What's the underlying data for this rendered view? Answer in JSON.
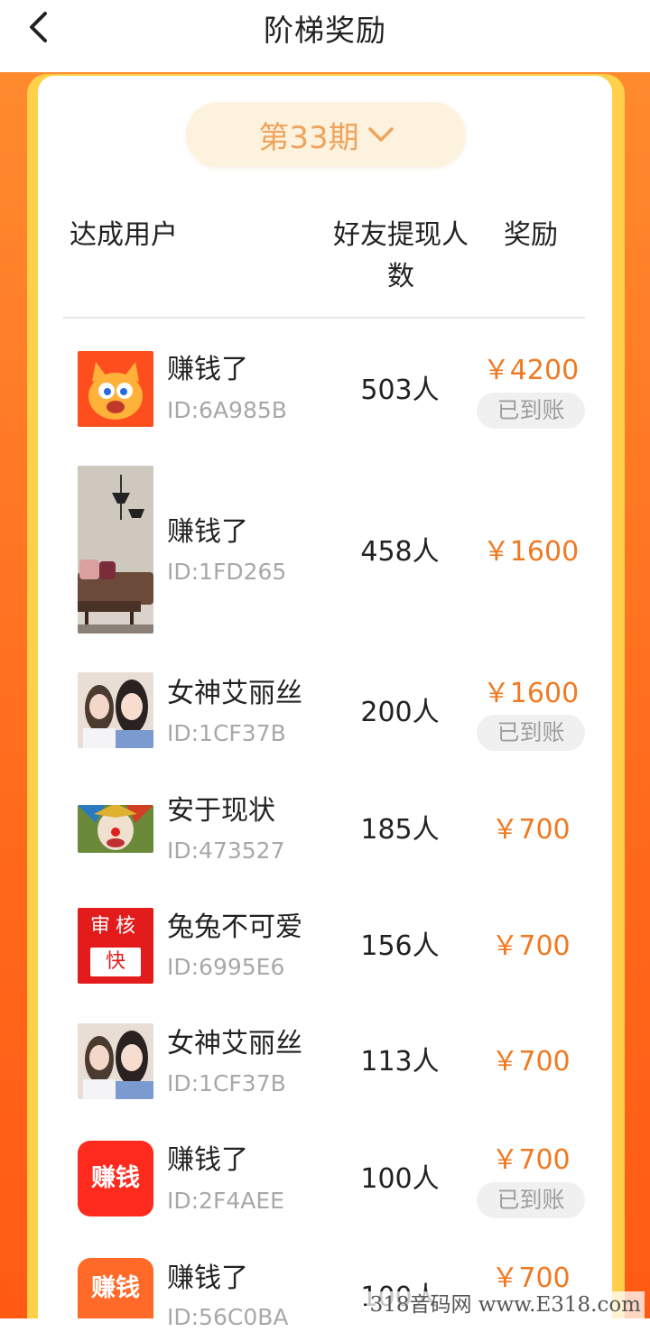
{
  "header": {
    "title": "阶梯奖励",
    "back_icon": "chevron-left-icon"
  },
  "period": {
    "label": "第33期",
    "icon": "chevron-down-icon"
  },
  "columns": {
    "user": "达成用户",
    "count_line1": "好友提现人",
    "count_line2": "数",
    "reward": "奖励"
  },
  "rows": [
    {
      "name": "赚钱了",
      "id": "ID:6A985B",
      "count": "503人",
      "reward": "￥4200",
      "status": "已到账"
    },
    {
      "name": "赚钱了",
      "id": "ID:1FD265",
      "count": "458人",
      "reward": "￥1600",
      "status": ""
    },
    {
      "name": "女神艾丽丝",
      "id": "ID:1CF37B",
      "count": "200人",
      "reward": "￥1600",
      "status": "已到账"
    },
    {
      "name": "安于现状",
      "id": "ID:473527",
      "count": "185人",
      "reward": "￥700",
      "status": ""
    },
    {
      "name": "兔兔不可爱",
      "id": "ID:6995E6",
      "count": "156人",
      "reward": "￥700",
      "status": ""
    },
    {
      "name": "女神艾丽丝",
      "id": "ID:1CF37B",
      "count": "113人",
      "reward": "￥700",
      "status": ""
    },
    {
      "name": "赚钱了",
      "id": "ID:2F4AEE",
      "count": "100人",
      "reward": "￥700",
      "status": "已到账"
    },
    {
      "name": "赚钱了",
      "id": "ID:56C0BA",
      "count": "100人",
      "reward": "￥700",
      "status": ""
    }
  ],
  "avatar_texts": {
    "audit_top": "审核",
    "audit_bottom": "快",
    "earn": "赚钱"
  },
  "watermark": "318音码网 www.E318.com",
  "colors": {
    "accent": "#f07a22",
    "background": "#ff6a1c",
    "frame": "#ffd04a",
    "period_bg": "#fdf2dd"
  }
}
